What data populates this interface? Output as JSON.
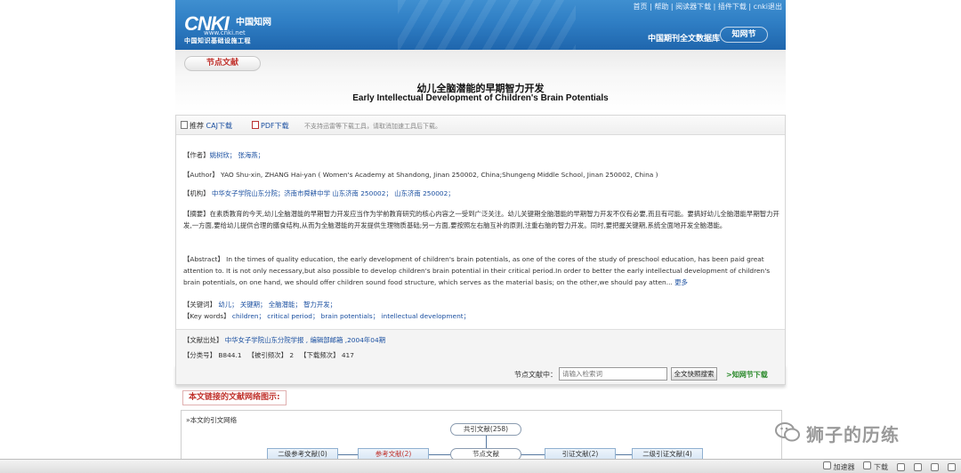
{
  "header": {
    "logo_text": "CNKI",
    "logo_cn": "中国知网",
    "logo_url": "www.cnki.net",
    "logo_sub": "中国知识基础设施工程",
    "top_links": [
      "首页",
      "帮助",
      "阅读器下载",
      "插件下载",
      "cnki退出"
    ],
    "db_name": "中国期刊全文数据库",
    "db_badge": "知网节"
  },
  "node": {
    "pill_label": "节点文献",
    "title_cn": "幼儿全脑潜能的早期智力开发",
    "title_en": "Early Intellectual Development of Children's Brain Potentials"
  },
  "download": {
    "caj_prefix": "推荐",
    "caj_label": "CAJ下载",
    "pdf_label": "PDF下载",
    "note": "不支持迅雷等下载工具，请取消加速工具后下载。"
  },
  "meta": {
    "author_label": "【作者】",
    "authors": "姚树欣； 张海燕；",
    "author_en_label": "【Author】",
    "author_en": "YAO Shu-xin, ZHANG Hai-yan ( Women's Academy at Shandong, Jinan 250002, China;Shungeng Middle School, Jinan 250002, China )",
    "org_label": "【机构】",
    "orgs": "中华女子学院山东分院；济南市舜耕中学 山东济南 250002； 山东济南 250002；",
    "abstract_label": "【摘要】",
    "abstract_cn": "在素质教育的今天,幼儿全脑潜能的早期智力开发应当作为学前教育研究的核心内容之一受到广泛关注。幼儿关键期全脑潜能的早期智力开发不仅有必要,而且有可能。要搞好幼儿全脑潜能早期智力开发,一方面,要给幼儿提供合理的膳食结构,从而为全脑潜能的开发提供生理物质基础;另一方面,要按照左右脑互补的原则,注重右脑的智力开发。同时,要把握关键期,系统全面地开发全脑潜能。",
    "abstract_en_label": "【Abstract】",
    "abstract_en": "In the times of quality education, the early development of children's brain potentials, as one of the cores of the study of preschool education, has been paid great attention to. It is not only necessary,but also possible to develop children's brain potential in their critical period.In order to better the early intellectual development of children's brain potentials, on one hand, we should offer children sound food structure, which serves as the material basis; on the other,we should pay atten...",
    "more_label": "更多",
    "keywords_label": "【关键词】",
    "keywords": "幼儿； 关键期； 全脑潜能； 智力开发；",
    "keywords_en_label": "【Key words】",
    "keywords_en": "children； critical period； brain potentials； intellectual development；",
    "source_label": "【文献出处】",
    "source": "中华女子学院山东分院学报 , 编辑部邮箱 ,2004年04期",
    "class_label": "【分类号】",
    "class_no": "B844.1",
    "cited_label": "【被引频次】",
    "cited": "2",
    "downloads_label": "【下载频次】",
    "downloads": "417"
  },
  "search": {
    "label": "节点文献中：",
    "placeholder": "请输入检索词",
    "button": "全文快照搜索",
    "node_dl": "知网节下载"
  },
  "network": {
    "title": "本文链接的文献网络图示:",
    "subtitle": "»本文的引文网络",
    "co_cite": "共引文献(258)",
    "ref2": "二级参考文献(0)",
    "ref1": "参考文献(2)",
    "node": "节点文献",
    "cite1": "引证文献(2)",
    "cite2": "二级引证文献(4)"
  },
  "watermark": {
    "text": "狮子的历练"
  },
  "statusbar": {
    "items": [
      "加速器",
      "下载",
      "",
      "",
      "",
      ""
    ]
  }
}
